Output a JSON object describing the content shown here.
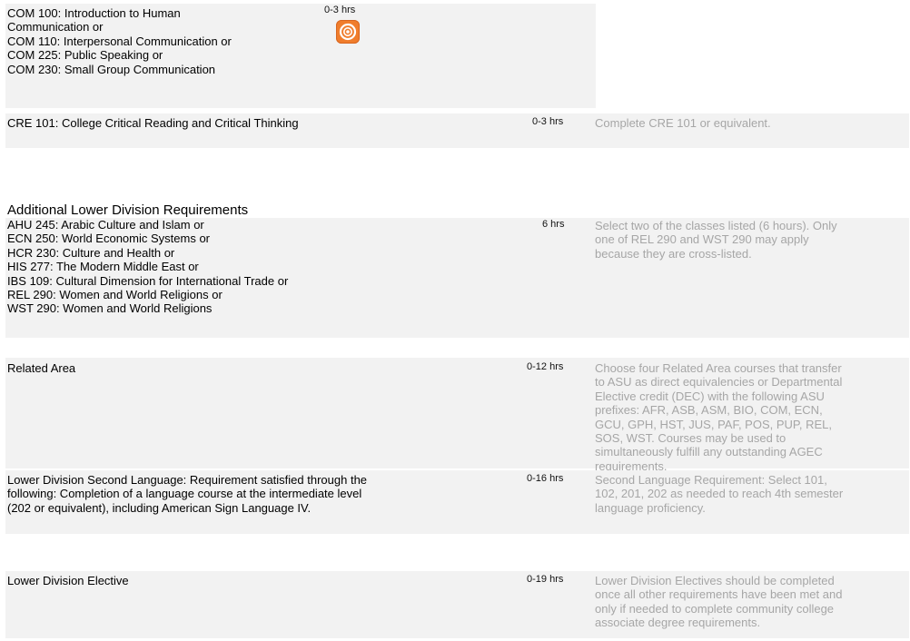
{
  "icon_name": "orange-target-icon",
  "rows": {
    "com": {
      "lines": [
        "COM 100: Introduction to Human",
        "Communication or",
        "COM 110: Interpersonal Communication or",
        "COM 225: Public Speaking or",
        "COM 230: Small Group Communication"
      ],
      "hours": "0-3 hrs"
    },
    "cre": {
      "course": "CRE 101: College Critical Reading and Critical Thinking",
      "hours": "0-3 hrs",
      "note": "Complete CRE 101 or equivalent."
    },
    "additional": {
      "lines": [
        "AHU 245: Arabic Culture and Islam or",
        "ECN 250: World Economic Systems or",
        "HCR 230: Culture and Health or",
        "HIS 277: The Modern Middle East or",
        "IBS 109: Cultural Dimension for International Trade or",
        "REL 290: Women and World Religions or",
        "WST 290: Women and World Religions"
      ],
      "hours": "6 hrs",
      "note_lines": [
        "Select two of the classes listed (6 hours). Only",
        "one of REL 290 and WST 290 may apply",
        "because they are cross-listed."
      ]
    },
    "related": {
      "course": "Related Area",
      "hours": "0-12 hrs",
      "note_lines": [
        "Choose four Related Area courses that transfer",
        "to ASU as direct equivalencies or Departmental",
        "Elective credit (DEC) with the following ASU",
        "prefixes: AFR, ASB, ASM, BIO, COM, ECN,",
        "GCU, GPH, HST, JUS, PAF, POS, PUP, REL,",
        "SOS, WST. Courses may be used to",
        "simultaneously fulfill any outstanding AGEC",
        "requirements."
      ]
    },
    "language": {
      "lines": [
        "Lower Division Second Language: Requirement satisfied through the",
        "following: Completion of a language course at the intermediate level",
        "(202 or equivalent), including American Sign Language IV."
      ],
      "hours": "0-16 hrs",
      "note_lines": [
        "Second Language Requirement: Select 101,",
        "102, 201, 202 as needed to reach 4th semester",
        "language proficiency."
      ]
    },
    "elective": {
      "course": "Lower Division Elective",
      "hours": "0-19 hrs",
      "note_lines": [
        "Lower Division Electives should be completed",
        "once all other requirements have been met and",
        "only if needed to complete community college",
        "associate degree requirements."
      ]
    }
  },
  "section_heading": "Additional Lower Division Requirements"
}
